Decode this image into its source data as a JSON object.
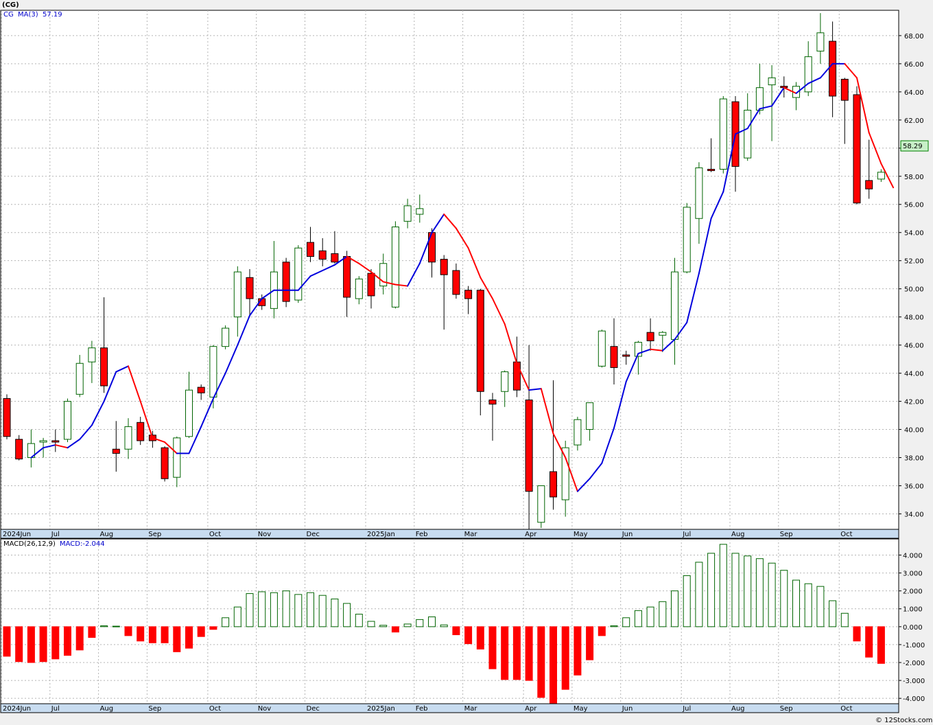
{
  "title": "(CG)",
  "watermark": "© 12Stocks.com",
  "price_panel": {
    "ticker": "CG",
    "ma_label": "MA(3)",
    "ma_value": "57.19",
    "last_price": "58.29"
  },
  "macd_panel": {
    "label": "MACD(26,12,9)",
    "value_label": "MACD:-2.044"
  },
  "colors": {
    "up": "#006400",
    "down": "#ff0000",
    "ma_up": "#0000dd",
    "ma_down": "#ff0000",
    "grid": "#b4b4b4",
    "axis_band": "#c8dcf0"
  },
  "chart_data": [
    {
      "type": "candlestick",
      "name": "CG weekly price",
      "ylim": [
        32.9,
        69.8
      ],
      "yticks": [
        "34.00",
        "36.00",
        "38.00",
        "40.00",
        "42.00",
        "44.00",
        "46.00",
        "48.00",
        "50.00",
        "52.00",
        "54.00",
        "56.00",
        "58.00",
        "60.00",
        "62.00",
        "64.00",
        "66.00",
        "68.00"
      ],
      "xlabels": [
        "2024Jun",
        "Jul",
        "Aug",
        "Sep",
        "Oct",
        "Nov",
        "Dec",
        "2025Jan",
        "Feb",
        "Mar",
        "Apr",
        "May",
        "Jun",
        "Jul",
        "Aug",
        "Sep",
        "Oct"
      ],
      "label_week_index": [
        0,
        4,
        8,
        12,
        17,
        21,
        25,
        30,
        34,
        38,
        43,
        47,
        51,
        56,
        60,
        64,
        69
      ],
      "candles": [
        {
          "o": 42.2,
          "h": 42.5,
          "l": 39.3,
          "c": 39.5
        },
        {
          "o": 39.3,
          "h": 39.6,
          "l": 37.8,
          "c": 37.9
        },
        {
          "o": 38.0,
          "h": 40.0,
          "l": 37.3,
          "c": 39.0
        },
        {
          "o": 39.1,
          "h": 39.4,
          "l": 38.0,
          "c": 39.2
        },
        {
          "o": 39.2,
          "h": 40.0,
          "l": 38.4,
          "c": 39.1
        },
        {
          "o": 39.3,
          "h": 42.2,
          "l": 39.1,
          "c": 42.0
        },
        {
          "o": 42.5,
          "h": 45.3,
          "l": 42.3,
          "c": 44.7
        },
        {
          "o": 44.8,
          "h": 46.3,
          "l": 43.3,
          "c": 45.8
        },
        {
          "o": 45.8,
          "h": 49.4,
          "l": 42.6,
          "c": 43.1
        },
        {
          "o": 38.6,
          "h": 40.6,
          "l": 37.0,
          "c": 38.3
        },
        {
          "o": 38.6,
          "h": 40.8,
          "l": 37.9,
          "c": 40.2
        },
        {
          "o": 40.5,
          "h": 40.9,
          "l": 38.9,
          "c": 39.2
        },
        {
          "o": 39.6,
          "h": 39.9,
          "l": 38.7,
          "c": 39.2
        },
        {
          "o": 38.7,
          "h": 38.8,
          "l": 36.3,
          "c": 36.5
        },
        {
          "o": 36.6,
          "h": 39.5,
          "l": 35.9,
          "c": 39.4
        },
        {
          "o": 39.5,
          "h": 44.1,
          "l": 39.4,
          "c": 42.8
        },
        {
          "o": 43.0,
          "h": 43.2,
          "l": 42.1,
          "c": 42.6
        },
        {
          "o": 42.3,
          "h": 46.0,
          "l": 41.5,
          "c": 45.9
        },
        {
          "o": 45.9,
          "h": 47.4,
          "l": 45.7,
          "c": 47.2
        },
        {
          "o": 48.0,
          "h": 51.6,
          "l": 46.6,
          "c": 51.2
        },
        {
          "o": 50.8,
          "h": 51.4,
          "l": 48.0,
          "c": 49.3
        },
        {
          "o": 49.3,
          "h": 49.6,
          "l": 48.5,
          "c": 48.8
        },
        {
          "o": 48.6,
          "h": 53.4,
          "l": 47.9,
          "c": 51.2
        },
        {
          "o": 51.9,
          "h": 52.2,
          "l": 48.7,
          "c": 49.1
        },
        {
          "o": 49.2,
          "h": 53.1,
          "l": 49.0,
          "c": 52.9
        },
        {
          "o": 53.3,
          "h": 54.4,
          "l": 51.9,
          "c": 52.3
        },
        {
          "o": 52.7,
          "h": 53.6,
          "l": 51.6,
          "c": 52.1
        },
        {
          "o": 52.5,
          "h": 54.1,
          "l": 51.8,
          "c": 51.9
        },
        {
          "o": 52.3,
          "h": 52.7,
          "l": 48.0,
          "c": 49.4
        },
        {
          "o": 49.3,
          "h": 50.9,
          "l": 48.9,
          "c": 50.7
        },
        {
          "o": 51.1,
          "h": 51.4,
          "l": 48.6,
          "c": 49.5
        },
        {
          "o": 50.2,
          "h": 52.5,
          "l": 49.6,
          "c": 51.8
        },
        {
          "o": 48.7,
          "h": 54.8,
          "l": 48.6,
          "c": 54.4
        },
        {
          "o": 54.8,
          "h": 56.4,
          "l": 54.3,
          "c": 55.9
        },
        {
          "o": 55.3,
          "h": 56.7,
          "l": 54.7,
          "c": 55.7
        },
        {
          "o": 54.0,
          "h": 54.3,
          "l": 50.8,
          "c": 51.9
        },
        {
          "o": 52.1,
          "h": 52.4,
          "l": 47.1,
          "c": 51.0
        },
        {
          "o": 51.3,
          "h": 51.8,
          "l": 49.3,
          "c": 49.6
        },
        {
          "o": 49.9,
          "h": 50.2,
          "l": 48.2,
          "c": 49.3
        },
        {
          "o": 49.9,
          "h": 50.0,
          "l": 41.0,
          "c": 42.7
        },
        {
          "o": 42.1,
          "h": 42.6,
          "l": 39.2,
          "c": 41.8
        },
        {
          "o": 42.7,
          "h": 44.2,
          "l": 41.6,
          "c": 44.1
        },
        {
          "o": 44.8,
          "h": 46.6,
          "l": 42.3,
          "c": 42.8
        },
        {
          "o": 42.1,
          "h": 46.0,
          "l": 32.9,
          "c": 35.6
        },
        {
          "o": 33.4,
          "h": 36.0,
          "l": 33.0,
          "c": 36.0
        },
        {
          "o": 37.0,
          "h": 43.5,
          "l": 34.3,
          "c": 35.2
        },
        {
          "o": 35.0,
          "h": 39.2,
          "l": 33.8,
          "c": 38.7
        },
        {
          "o": 38.9,
          "h": 40.9,
          "l": 38.5,
          "c": 40.7
        },
        {
          "o": 40.0,
          "h": 41.6,
          "l": 39.2,
          "c": 41.9
        },
        {
          "o": 44.5,
          "h": 47.1,
          "l": 44.4,
          "c": 47.0
        },
        {
          "o": 45.9,
          "h": 47.9,
          "l": 43.2,
          "c": 44.4
        },
        {
          "o": 45.3,
          "h": 45.6,
          "l": 44.6,
          "c": 45.2
        },
        {
          "o": 45.2,
          "h": 46.3,
          "l": 43.9,
          "c": 46.2
        },
        {
          "o": 46.9,
          "h": 47.9,
          "l": 45.6,
          "c": 46.3
        },
        {
          "o": 46.7,
          "h": 47.0,
          "l": 45.5,
          "c": 46.9
        },
        {
          "o": 46.4,
          "h": 52.2,
          "l": 44.6,
          "c": 51.2
        },
        {
          "o": 51.2,
          "h": 56.1,
          "l": 51.1,
          "c": 55.8
        },
        {
          "o": 55.0,
          "h": 59.0,
          "l": 53.2,
          "c": 58.6
        },
        {
          "o": 58.5,
          "h": 60.7,
          "l": 58.3,
          "c": 58.4
        },
        {
          "o": 58.5,
          "h": 63.7,
          "l": 58.2,
          "c": 63.5
        },
        {
          "o": 63.3,
          "h": 63.7,
          "l": 56.9,
          "c": 58.7
        },
        {
          "o": 59.3,
          "h": 63.9,
          "l": 59.1,
          "c": 62.7
        },
        {
          "o": 62.7,
          "h": 66.0,
          "l": 62.4,
          "c": 64.3
        },
        {
          "o": 64.5,
          "h": 65.9,
          "l": 60.5,
          "c": 65.0
        },
        {
          "o": 64.4,
          "h": 65.1,
          "l": 63.6,
          "c": 64.3
        },
        {
          "o": 63.6,
          "h": 64.7,
          "l": 62.7,
          "c": 64.4
        },
        {
          "o": 64.0,
          "h": 67.6,
          "l": 63.7,
          "c": 66.5
        },
        {
          "o": 66.9,
          "h": 69.6,
          "l": 66.0,
          "c": 68.2
        },
        {
          "o": 67.6,
          "h": 69.0,
          "l": 62.2,
          "c": 63.7
        },
        {
          "o": 64.9,
          "h": 65.0,
          "l": 60.3,
          "c": 63.4
        },
        {
          "o": 63.8,
          "h": 64.4,
          "l": 56.0,
          "c": 56.1
        },
        {
          "o": 57.7,
          "h": 60.6,
          "l": 56.4,
          "c": 57.1
        },
        {
          "o": 57.8,
          "h": 58.5,
          "l": 57.6,
          "c": 58.29
        }
      ],
      "ma3": [
        null,
        null,
        38.0,
        38.7,
        38.9,
        38.7,
        39.3,
        40.3,
        42.0,
        44.1,
        44.5,
        42.0,
        39.4,
        39.1,
        38.3,
        38.3,
        40.2,
        42.2,
        44.0,
        46.0,
        48.1,
        49.3,
        49.9,
        49.9,
        49.9,
        50.9,
        51.3,
        51.7,
        52.3,
        51.8,
        51.2,
        50.5,
        50.3,
        50.2,
        51.8,
        54.0,
        55.3,
        54.3,
        52.9,
        50.8,
        49.3,
        47.5,
        44.7,
        42.8,
        42.9,
        39.7,
        38.0,
        35.6,
        36.5,
        37.6,
        40.1,
        43.4,
        45.4,
        45.7,
        45.6,
        46.4,
        47.6,
        51.1,
        55.0,
        56.9,
        61.0,
        61.4,
        62.8,
        63.0,
        64.3,
        63.9,
        64.6,
        65.0,
        66.0,
        66.0,
        65.0,
        61.1,
        58.9,
        57.2
      ]
    },
    {
      "type": "bar",
      "name": "MACD",
      "ylim": [
        -4.3,
        4.9
      ],
      "yticks": [
        "-4.000",
        "-3.000",
        "-2.000",
        "-1.000",
        "0.000",
        "1.000",
        "2.000",
        "3.000",
        "4.000"
      ],
      "values": [
        -1.65,
        -1.95,
        -2.0,
        -1.95,
        -1.8,
        -1.6,
        -1.3,
        -0.6,
        0.05,
        0.03,
        -0.5,
        -0.8,
        -0.9,
        -0.9,
        -1.4,
        -1.2,
        -0.55,
        -0.15,
        0.5,
        1.1,
        1.85,
        1.95,
        1.9,
        2.0,
        1.8,
        1.9,
        1.75,
        1.55,
        1.3,
        0.7,
        0.3,
        0.08,
        -0.3,
        0.15,
        0.4,
        0.55,
        0.1,
        -0.45,
        -0.95,
        -1.25,
        -2.35,
        -2.95,
        -2.95,
        -3.0,
        -3.95,
        -4.3,
        -3.5,
        -2.7,
        -1.85,
        -0.5,
        0.05,
        0.5,
        0.9,
        1.1,
        1.4,
        2.0,
        2.85,
        3.6,
        4.1,
        4.6,
        4.1,
        3.95,
        3.8,
        3.55,
        3.15,
        2.6,
        2.4,
        2.25,
        1.45,
        0.75,
        -0.8,
        -1.7,
        -2.05
      ]
    }
  ]
}
